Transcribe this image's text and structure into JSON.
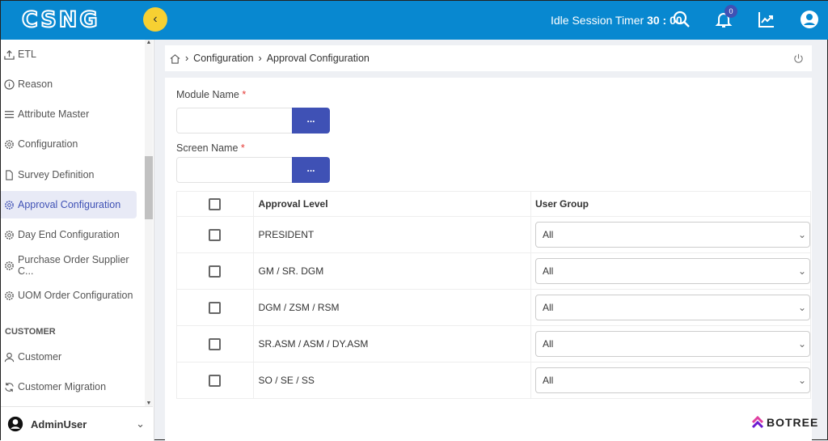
{
  "header": {
    "logo": "CSNG",
    "timer_label": "Idle Session Timer",
    "timer_value": "30 : 00",
    "notifications": "0",
    "accent": "#0888d0"
  },
  "sidebar": {
    "items": [
      {
        "label": "ETL",
        "icon": "upload-icon"
      },
      {
        "label": "Reason",
        "icon": "info-icon"
      },
      {
        "label": "Attribute Master",
        "icon": "list-icon"
      },
      {
        "label": "Configuration",
        "icon": "gear-icon"
      },
      {
        "label": "Survey Definition",
        "icon": "document-icon"
      },
      {
        "label": "Approval Configuration",
        "icon": "gear-icon",
        "active": true
      },
      {
        "label": "Day End Configuration",
        "icon": "gear-icon"
      },
      {
        "label": "Purchase Order Supplier C...",
        "icon": "gear-icon"
      },
      {
        "label": "UOM Order Configuration",
        "icon": "gear-icon"
      }
    ],
    "section": "CUSTOMER",
    "customer_items": [
      {
        "label": "Customer",
        "icon": "user-icon"
      },
      {
        "label": "Customer Migration",
        "icon": "refresh-icon"
      }
    ],
    "user": "AdminUser"
  },
  "breadcrumb": [
    "Configuration",
    "Approval Configuration"
  ],
  "form": {
    "module_label": "Module Name",
    "screen_label": "Screen Name",
    "required": "*",
    "module_value": "",
    "screen_value": "",
    "lookup_label": "..."
  },
  "table": {
    "headers": [
      "Approval Level",
      "User Group"
    ],
    "rows": [
      {
        "level": "PRESIDENT",
        "group": "All"
      },
      {
        "level": "GM / SR. DGM",
        "group": "All"
      },
      {
        "level": "DGM / ZSM / RSM",
        "group": "All"
      },
      {
        "level": "SR.ASM / ASM / DY.ASM",
        "group": "All"
      },
      {
        "level": "SO / SE / SS",
        "group": "All"
      }
    ]
  },
  "brand": "BOTREE"
}
